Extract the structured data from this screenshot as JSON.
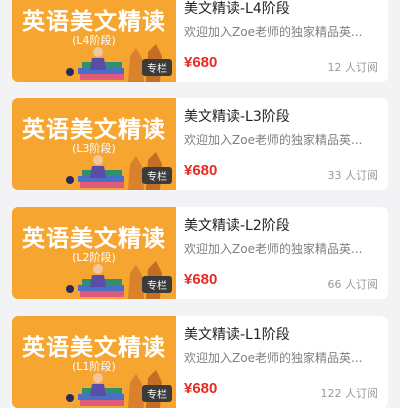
{
  "products": [
    {
      "cover_title": "英语美文精读",
      "cover_stage": "(L4阶段)",
      "tag": "专栏",
      "title": "美文精读-L4阶段",
      "description": "欢迎加入Zoe老师的独家精品英...",
      "price": "¥680",
      "subscribers": "12 人订阅"
    },
    {
      "cover_title": "英语美文精读",
      "cover_stage": "(L3阶段)",
      "tag": "专栏",
      "title": "美文精读-L3阶段",
      "description": "欢迎加入Zoe老师的独家精品英...",
      "price": "¥680",
      "subscribers": "33 人订阅"
    },
    {
      "cover_title": "英语美文精读",
      "cover_stage": "(L2阶段)",
      "tag": "专栏",
      "title": "美文精读-L2阶段",
      "description": "欢迎加入Zoe老师的独家精品英...",
      "price": "¥680",
      "subscribers": "66 人订阅"
    },
    {
      "cover_title": "英语美文精读",
      "cover_stage": "(L1阶段)",
      "tag": "专栏",
      "title": "美文精读-L1阶段",
      "description": "欢迎加入Zoe老师的独家精品英...",
      "price": "¥680",
      "subscribers": "122 人订阅"
    }
  ],
  "colors": {
    "cover_background": "#f6a531",
    "price": "#e42b25",
    "page_background": "#f3f3f5"
  }
}
